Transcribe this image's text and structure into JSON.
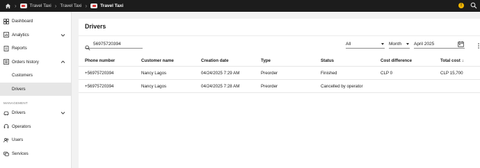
{
  "topbar": {
    "crumbs": [
      "Travel Taxi",
      "Travel Taxi",
      "Travel Taxi"
    ],
    "status_badge": "!"
  },
  "sidebar": {
    "items": [
      {
        "label": "Dashboard",
        "icon": "dashboard-icon"
      },
      {
        "label": "Analytics",
        "icon": "analytics-icon"
      },
      {
        "label": "Reports",
        "icon": "reports-icon"
      },
      {
        "label": "Orders history",
        "icon": "orders-history-icon"
      },
      {
        "label": "Customers"
      },
      {
        "label": "Drivers"
      }
    ],
    "section_label": "MANAGEMENT",
    "management_items": [
      {
        "label": "Drivers",
        "icon": "driver-icon"
      },
      {
        "label": "Operators",
        "icon": "headset-icon"
      },
      {
        "label": "Users",
        "icon": "users-icon"
      },
      {
        "label": "Services",
        "icon": "services-icon"
      }
    ]
  },
  "main": {
    "title": "Drivers",
    "search_value": "56975720394",
    "filter_value": "All",
    "period_value": "Month",
    "date_value": "April 2025",
    "columns": [
      "Phone number",
      "Customer name",
      "Creation date",
      "Type",
      "Status",
      "Cost difference",
      "Total cost"
    ],
    "sort_indicator": "↓",
    "rows": [
      [
        "+56975720394",
        "Nancy Lagos",
        "04/24/2025 7:29 AM",
        "Preorder",
        "Finished",
        "CLP 0",
        "CLP 15,700"
      ],
      [
        "+56975720394",
        "Nancy Lagos",
        "04/24/2025 7:28 AM",
        "Preorder",
        "Cancelled by operator",
        "",
        ""
      ]
    ]
  },
  "colors": {
    "topbar": "#1c1c1c",
    "badge": "#f0b400",
    "active_nav": "#e6e6e6"
  }
}
